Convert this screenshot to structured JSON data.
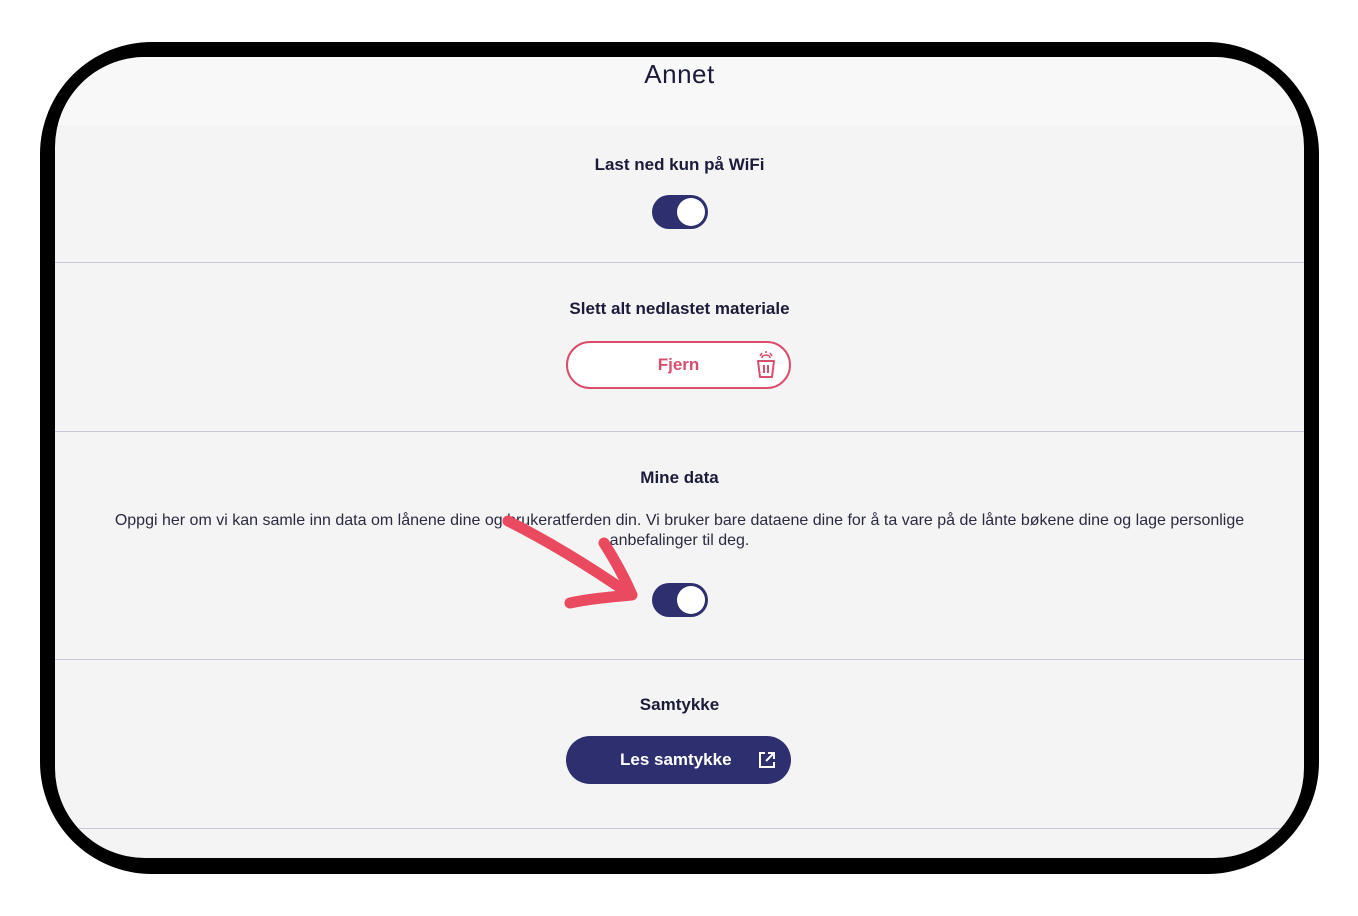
{
  "header": {
    "title": "Annet"
  },
  "wifi": {
    "label": "Last ned kun på WiFi",
    "enabled": true
  },
  "delete": {
    "label": "Slett alt nedlastet materiale",
    "button": "Fjern"
  },
  "mydata": {
    "label": "Mine data",
    "description_line1": "Oppgi her om vi kan samle inn data om lånene dine og brukeratferden din. Vi bruker bare dataene dine for å ta vare på de lånte bøkene dine og lage personlige",
    "description_line2": "anbefalinger til deg.",
    "enabled": true
  },
  "consent": {
    "label": "Samtykke",
    "button": "Les samtykke"
  },
  "colors": {
    "primary": "#2e2f6e",
    "danger": "#d94e6e",
    "annotation": "#e94a5f"
  },
  "icons": [
    "back-arrow-icon",
    "trash-icon",
    "external-link-icon",
    "annotation-arrow-icon"
  ]
}
